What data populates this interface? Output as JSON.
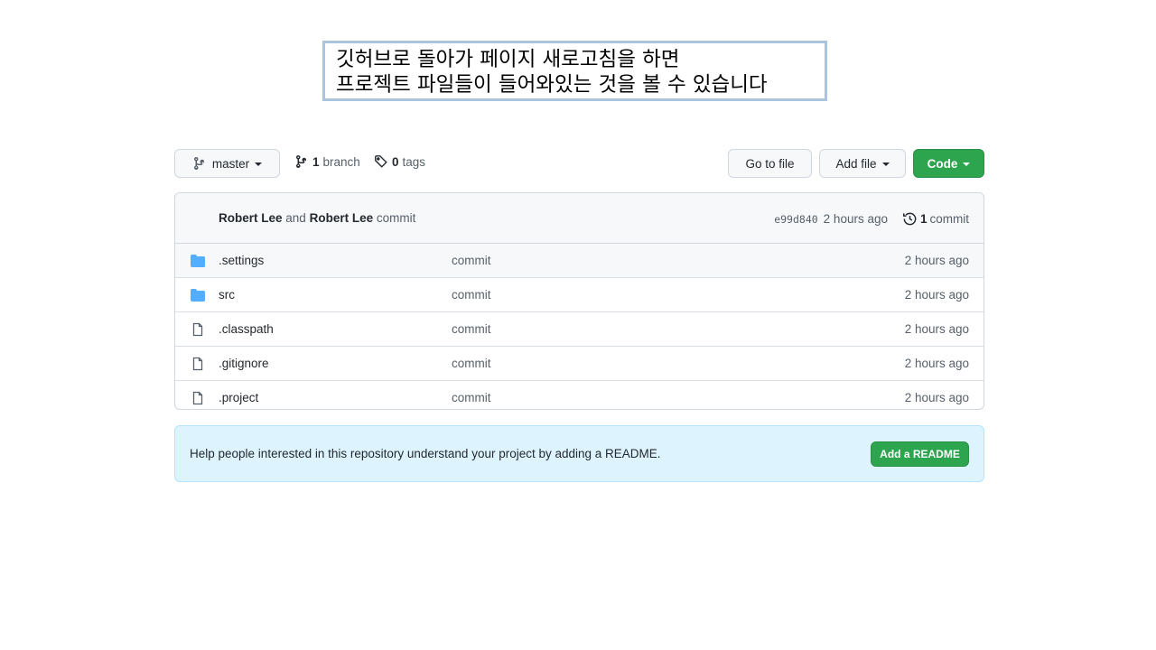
{
  "caption": {
    "line1": "깃허브로 돌아가 페이지 새로고침을 하면",
    "line2": "프로젝트 파일들이 들어와있는 것을 볼 수 있습니다"
  },
  "toolbar": {
    "branch_label": "master",
    "branch_count": "1",
    "branch_word": "branch",
    "tag_count": "0",
    "tag_word": "tags",
    "goto_file": "Go to file",
    "add_file": "Add file",
    "code": "Code"
  },
  "latest_commit": {
    "author1": "Robert Lee",
    "joiner": "and",
    "author2": "Robert Lee",
    "message": "commit",
    "sha": "e99d840",
    "age": "2 hours ago",
    "commit_count": "1",
    "commit_word": "commit"
  },
  "files": [
    {
      "name": ".settings",
      "type": "folder",
      "message": "commit",
      "age": "2 hours ago"
    },
    {
      "name": "src",
      "type": "folder",
      "message": "commit",
      "age": "2 hours ago"
    },
    {
      "name": ".classpath",
      "type": "file",
      "message": "commit",
      "age": "2 hours ago"
    },
    {
      "name": ".gitignore",
      "type": "file",
      "message": "commit",
      "age": "2 hours ago"
    },
    {
      "name": ".project",
      "type": "file",
      "message": "commit",
      "age": "2 hours ago"
    }
  ],
  "readme": {
    "text": "Help people interested in this repository understand your project by adding a README.",
    "button": "Add a README"
  },
  "colors": {
    "primary_green": "#2da44e",
    "folder_blue": "#54aeff",
    "readme_bg": "#ddf4ff",
    "caption_border": "#a9c4dc"
  }
}
